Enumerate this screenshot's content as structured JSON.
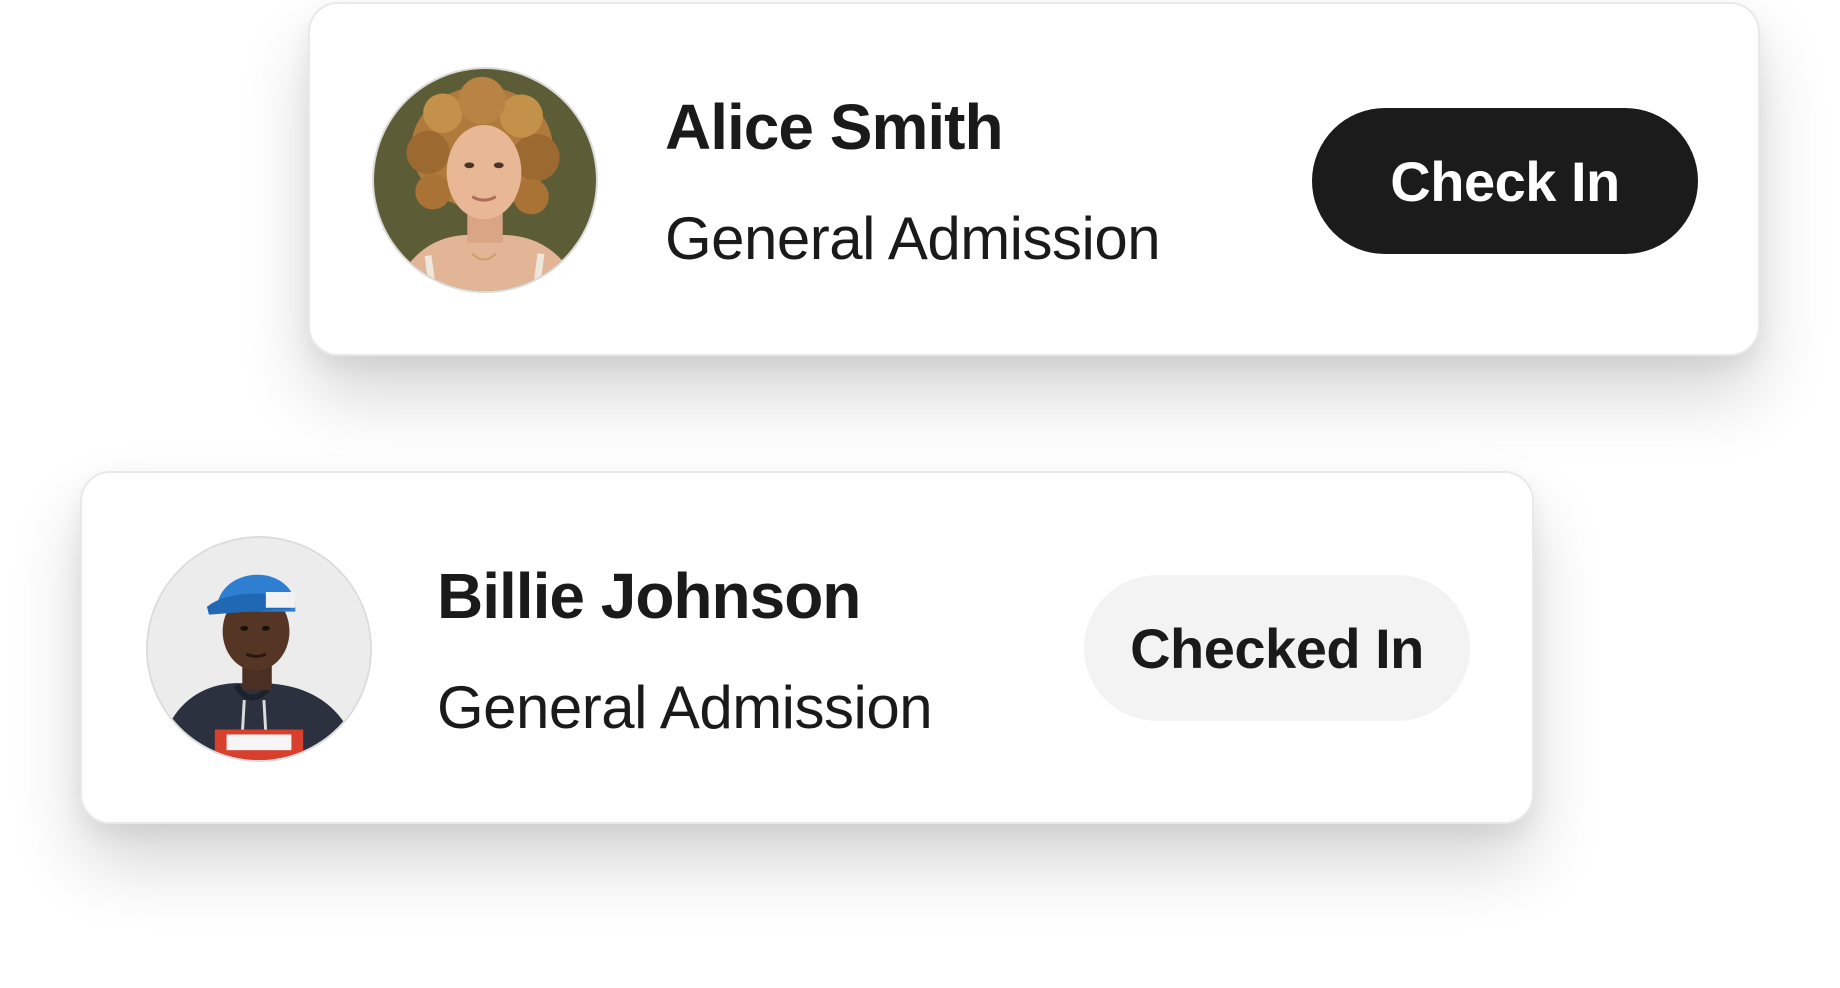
{
  "attendees": [
    {
      "name": "Alice Smith",
      "ticket_type": "General Admission",
      "action_label": "Check In",
      "status": "pending"
    },
    {
      "name": "Billie Johnson",
      "ticket_type": "General Admission",
      "action_label": "Checked In",
      "status": "checked-in"
    }
  ],
  "colors": {
    "primary_button_bg": "#1b1b1b",
    "primary_button_text": "#ffffff",
    "secondary_button_bg": "#f3f3f3",
    "text": "#1a1a1a"
  }
}
